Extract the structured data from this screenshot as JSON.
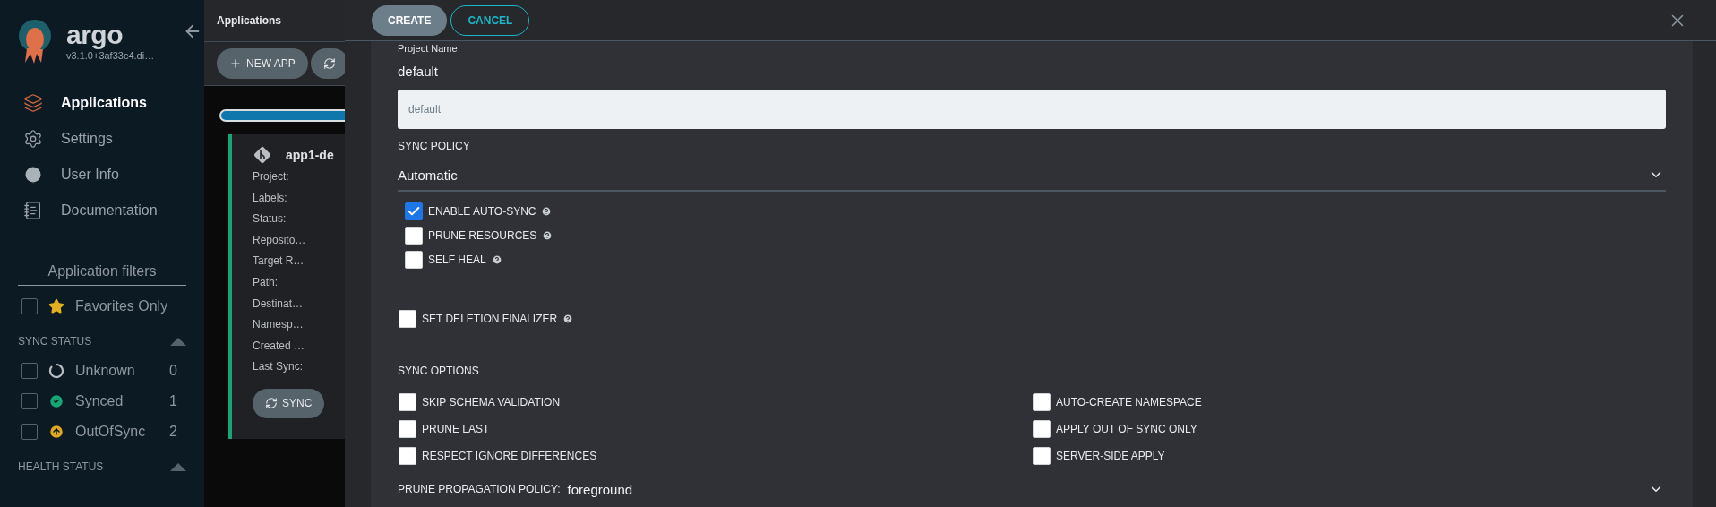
{
  "sidebar": {
    "brand": "argo",
    "version": "v3.1.0+3af33c4.di…",
    "nav": [
      {
        "label": "Applications",
        "kind": "layers",
        "selected": true
      },
      {
        "label": "Settings",
        "kind": "settings",
        "selected": false
      },
      {
        "label": "User Info",
        "kind": "user",
        "selected": false
      },
      {
        "label": "Documentation",
        "kind": "docs",
        "selected": false
      }
    ],
    "filters_title": "Application filters",
    "favorites": {
      "label": "Favorites Only",
      "checked": false
    },
    "sections": [
      {
        "title": "SYNC STATUS",
        "expanded": true,
        "items": [
          {
            "label": "Unknown",
            "count": "0",
            "checked": false,
            "kind": "unknown"
          },
          {
            "label": "Synced",
            "count": "1",
            "checked": false,
            "kind": "synced"
          },
          {
            "label": "OutOfSync",
            "count": "2",
            "checked": false,
            "kind": "outofsync"
          }
        ]
      },
      {
        "title": "HEALTH STATUS",
        "expanded": true
      }
    ]
  },
  "apps_page": {
    "title": "Applications",
    "new_app": "NEW APP",
    "card": {
      "title": "app1-de",
      "fields": [
        "Project:",
        "Labels:",
        "Status:",
        "Reposito…",
        "Target R…",
        "Path:",
        "Destinat…",
        "Namesp…",
        "Created …",
        "Last Sync:"
      ],
      "button": "SYNC"
    }
  },
  "panel": {
    "buttons": [
      {
        "label": "CREATE",
        "kind": "primary"
      },
      {
        "label": "CANCEL",
        "kind": "outline"
      }
    ],
    "project": {
      "label": "Project Name",
      "value": "default",
      "input_value": "default"
    },
    "sync_policy": {
      "label": "SYNC POLICY",
      "value": "Automatic",
      "options": [
        {
          "label": "ENABLE AUTO-SYNC",
          "checked": true,
          "help": true
        },
        {
          "label": "PRUNE RESOURCES",
          "checked": false,
          "help": true
        },
        {
          "label": "SELF HEAL",
          "checked": false,
          "help": true
        }
      ]
    },
    "deletion_finalizer": {
      "label": "SET DELETION FINALIZER",
      "checked": false,
      "help": true
    },
    "sync_options": {
      "title": "SYNC OPTIONS",
      "columns": [
        [
          {
            "label": "SKIP SCHEMA VALIDATION",
            "checked": false
          },
          {
            "label": "PRUNE LAST",
            "checked": false
          },
          {
            "label": "RESPECT IGNORE DIFFERENCES",
            "checked": false
          }
        ],
        [
          {
            "label": "AUTO-CREATE NAMESPACE",
            "checked": false
          },
          {
            "label": "APPLY OUT OF SYNC ONLY",
            "checked": false
          },
          {
            "label": "SERVER-SIDE APPLY",
            "checked": false
          }
        ]
      ]
    },
    "prune_propagation": {
      "label": "PRUNE PROPAGATION POLICY:",
      "value": "foreground"
    }
  }
}
